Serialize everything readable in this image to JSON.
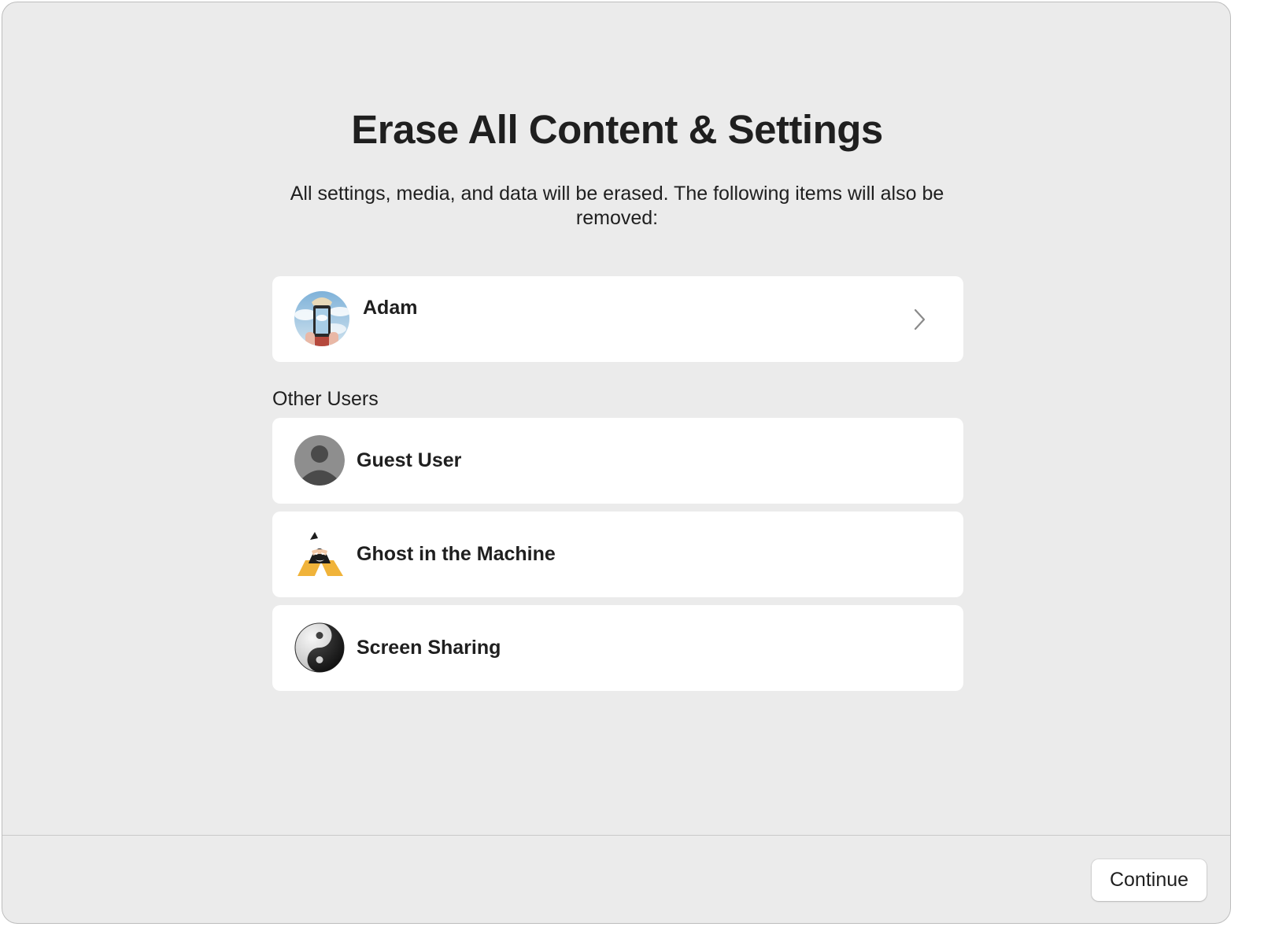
{
  "dialog": {
    "title": "Erase All Content & Settings",
    "subtitle": "All settings, media, and data will be erased. The following items will also be removed:"
  },
  "primary_user": {
    "name": "Adam",
    "avatar_icon": "photo-avatar-icon",
    "action_icon": "chevron-right-icon"
  },
  "other_users": {
    "section_label": "Other Users",
    "items": [
      {
        "name": "Guest User",
        "avatar_icon": "generic-person-avatar-icon"
      },
      {
        "name": "Ghost in the Machine",
        "avatar_icon": "masked-hero-avatar-icon"
      },
      {
        "name": "Screen Sharing",
        "avatar_icon": "yin-yang-avatar-icon"
      }
    ]
  },
  "footer": {
    "continue_label": "Continue"
  },
  "colors": {
    "window_background": "#ebebeb",
    "card_background": "#ffffff",
    "text": "#1f1f1f",
    "divider": "#c9c9c9",
    "chevron": "#8a8a8a"
  }
}
